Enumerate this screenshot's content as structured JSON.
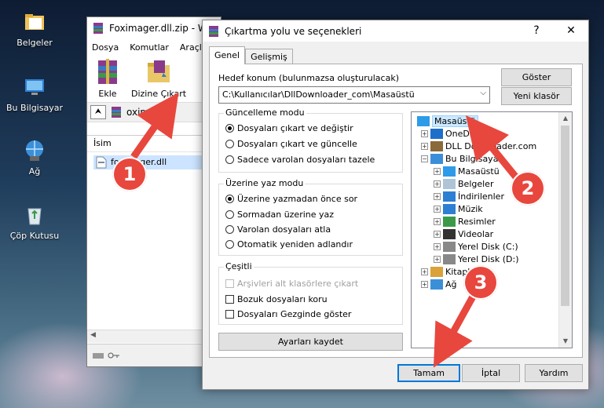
{
  "desktop": {
    "icons": [
      {
        "label": "Belgeler",
        "icon": "folder-icon"
      },
      {
        "label": "Bu Bilgisayar",
        "icon": "computer-icon"
      },
      {
        "label": "Ağ",
        "icon": "network-icon"
      },
      {
        "label": "Çöp Kutusu",
        "icon": "recycle-bin-icon"
      }
    ]
  },
  "winrar": {
    "title": "Foximager.dll.zip - W",
    "menu": [
      "Dosya",
      "Komutlar",
      "Araçla"
    ],
    "toolbar": {
      "add_label": "Ekle",
      "extract_label": "Dizine Çıkart"
    },
    "path": "oximager.",
    "column_name": "İsim",
    "file": "foximager.dll"
  },
  "dialog": {
    "title": "Çıkartma yolu ve seçenekleri",
    "help_btn": "?",
    "close_btn": "✕",
    "tabs": [
      "Genel",
      "Gelişmiş"
    ],
    "dest_label": "Hedef konum (bulunmazsa oluşturulacak)",
    "dest_value": "C:\\Kullanıcılar\\DllDownloader_com\\Masaüstü",
    "show_btn": "Göster",
    "new_folder_btn": "Yeni klasör",
    "update_group": {
      "title": "Güncelleme modu",
      "options": [
        "Dosyaları çıkart ve değiştir",
        "Dosyaları çıkart ve güncelle",
        "Sadece varolan dosyaları tazele"
      ],
      "selected": 0
    },
    "overwrite_group": {
      "title": "Üzerine yaz modu",
      "options": [
        "Üzerine yazmadan önce sor",
        "Sormadan üzerine yaz",
        "Varolan dosyaları atla",
        "Otomatik yeniden adlandır"
      ],
      "selected": 0
    },
    "misc_group": {
      "title": "Çeşitli",
      "options": [
        "Arşivleri alt klasörlere çıkart",
        "Bozuk dosyaları koru",
        "Dosyaları Gezginde göster"
      ],
      "disabled": [
        true,
        false,
        false
      ],
      "checked": [
        false,
        false,
        false
      ]
    },
    "save_settings_btn": "Ayarları kaydet",
    "tree": [
      {
        "label": "Masaüstü",
        "icon": "desktop-icon",
        "selected": true,
        "expander": ""
      },
      {
        "label": "OneDrive",
        "icon": "onedrive-icon",
        "expander": "+"
      },
      {
        "label": "DLL Downloader.com",
        "icon": "user-icon",
        "expander": "+"
      },
      {
        "label": "Bu Bilgisayar",
        "icon": "computer-icon",
        "expander": "−"
      },
      {
        "label": "Masaüstü",
        "icon": "desktop-icon",
        "expander": "+"
      },
      {
        "label": "Belgeler",
        "icon": "document-icon",
        "expander": "+"
      },
      {
        "label": "İndirilenler",
        "icon": "download-icon",
        "expander": "+"
      },
      {
        "label": "Müzik",
        "icon": "music-icon",
        "expander": "+"
      },
      {
        "label": "Resimler",
        "icon": "pictures-icon",
        "expander": "+"
      },
      {
        "label": "Videolar",
        "icon": "videos-icon",
        "expander": "+"
      },
      {
        "label": "Yerel Disk (C:)",
        "icon": "drive-icon",
        "expander": "+"
      },
      {
        "label": "Yerel Disk (D:)",
        "icon": "drive-icon",
        "expander": "+"
      },
      {
        "label": "Kitaplıklar",
        "icon": "library-icon",
        "expander": "+"
      },
      {
        "label": "Ağ",
        "icon": "network-icon",
        "expander": "+"
      }
    ],
    "ok_btn": "Tamam",
    "cancel_btn": "İptal",
    "help_button": "Yardım"
  },
  "annotations": {
    "steps": [
      "1",
      "2",
      "3"
    ],
    "color": "#e8473e"
  }
}
